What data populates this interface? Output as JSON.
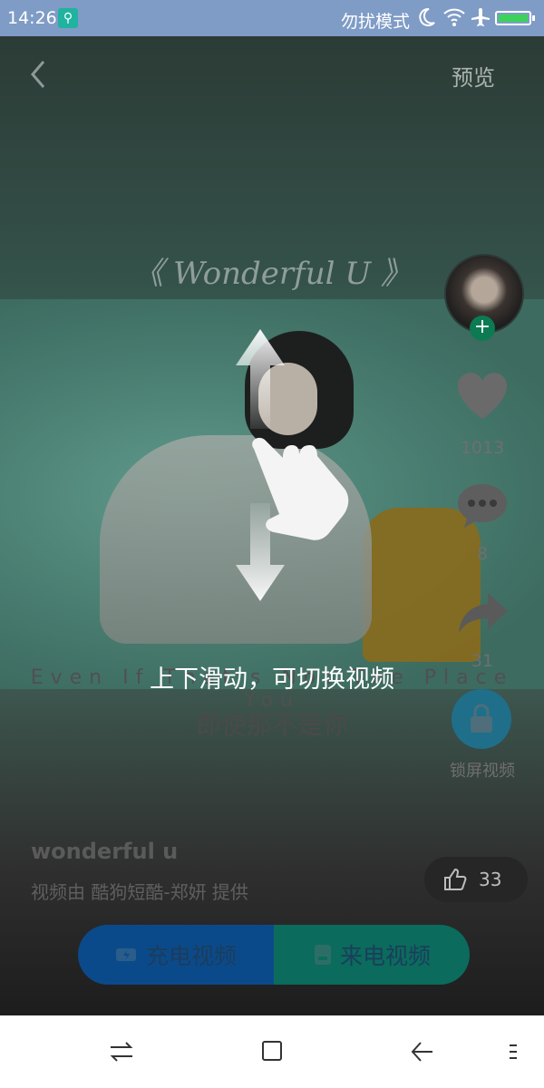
{
  "status_bar": {
    "time": "14:26",
    "dnd_label": "勿扰模式"
  },
  "top_nav": {
    "back_icon": "chevron-left-icon",
    "preview_label": "预览"
  },
  "song_title": "《 Wonderful U 》",
  "right_rail": {
    "like_count": "1013",
    "comment_count": "8",
    "share_count": "31",
    "lock_label": "锁屏视频"
  },
  "lyrics": {
    "english": "Even If That's Not The Place You",
    "chinese": "即使那不是你"
  },
  "bottom_info": {
    "video_name": "wonderful u",
    "credit": "视频由 酷狗短酷-郑妍 提供"
  },
  "like_pill": {
    "count": "33"
  },
  "action_bar": {
    "charge_label": "充电视频",
    "call_label": "来电视频",
    "charge_color": "#0b4a8a",
    "call_color": "#0b6b5c"
  },
  "guide": {
    "text": "上下滑动，可切换视频"
  },
  "colors": {
    "status_bar": "#7f9cc6",
    "follow_badge": "#0c7a52"
  }
}
